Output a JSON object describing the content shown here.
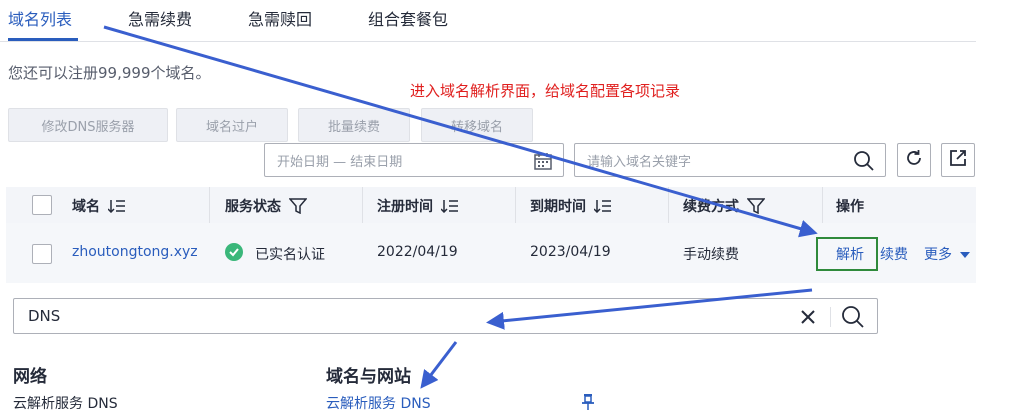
{
  "tabs": [
    {
      "label": "域名列表",
      "active": true
    },
    {
      "label": "急需续费",
      "active": false
    },
    {
      "label": "急需赎回",
      "active": false
    },
    {
      "label": "组合套餐包",
      "active": false
    }
  ],
  "hint": "您还可以注册99,999个域名。",
  "annotation": "进入域名解析界面，给域名配置各项记录",
  "toolbar": {
    "modify_dns": "修改DNS服务器",
    "transfer_owner": "域名过户",
    "batch_renew": "批量续费",
    "transfer_domain": "转移域名"
  },
  "filters": {
    "date_placeholder": "开始日期 — 结束日期",
    "search_placeholder": "请输入域名关键字"
  },
  "table": {
    "headers": {
      "domain": "域名",
      "status": "服务状态",
      "registered": "注册时间",
      "expires": "到期时间",
      "renew_mode": "续费方式",
      "actions": "操作"
    },
    "rows": [
      {
        "domain": "zhoutongtong.xyz",
        "status": "已实名认证",
        "registered": "2022/04/19",
        "expires": "2023/04/19",
        "renew_mode": "手动续费",
        "action_resolve": "解析",
        "action_renew": "续费",
        "action_more": "更多"
      }
    ]
  },
  "search": {
    "value": "DNS"
  },
  "results": {
    "group_network": "网络",
    "group_domain": "域名与网站",
    "item_network": "云解析服务 DNS",
    "item_domain": "云解析服务 DNS"
  },
  "colors": {
    "accent": "#2a5dbd",
    "annotation": "#e0201f",
    "highlight_box": "#2f8a3b",
    "arrow": "#3a5fcf",
    "status_ok": "#3ab77a"
  },
  "icons": [
    "calendar-icon",
    "search-icon",
    "refresh-icon",
    "export-icon",
    "sort-icon",
    "filter-icon",
    "check-circle-icon",
    "chevron-down-icon",
    "clear-icon",
    "pin-icon"
  ]
}
